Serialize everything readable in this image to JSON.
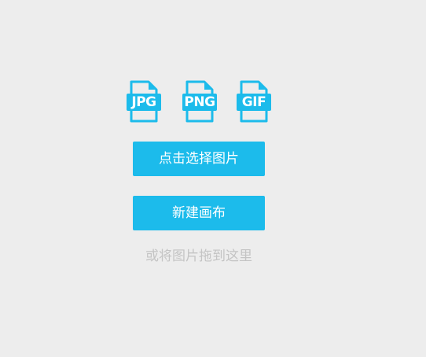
{
  "colors": {
    "background": "#ededed",
    "accent": "#1cbbeb",
    "hint_text": "#c4c4c4"
  },
  "file_icons": [
    {
      "icon": "jpg-file-icon",
      "label": "JPG"
    },
    {
      "icon": "png-file-icon",
      "label": "PNG"
    },
    {
      "icon": "gif-file-icon",
      "label": "GIF"
    }
  ],
  "actions": {
    "select_image_label": "点击选择图片",
    "new_canvas_label": "新建画布"
  },
  "drop_hint": "或将图片拖到这里"
}
